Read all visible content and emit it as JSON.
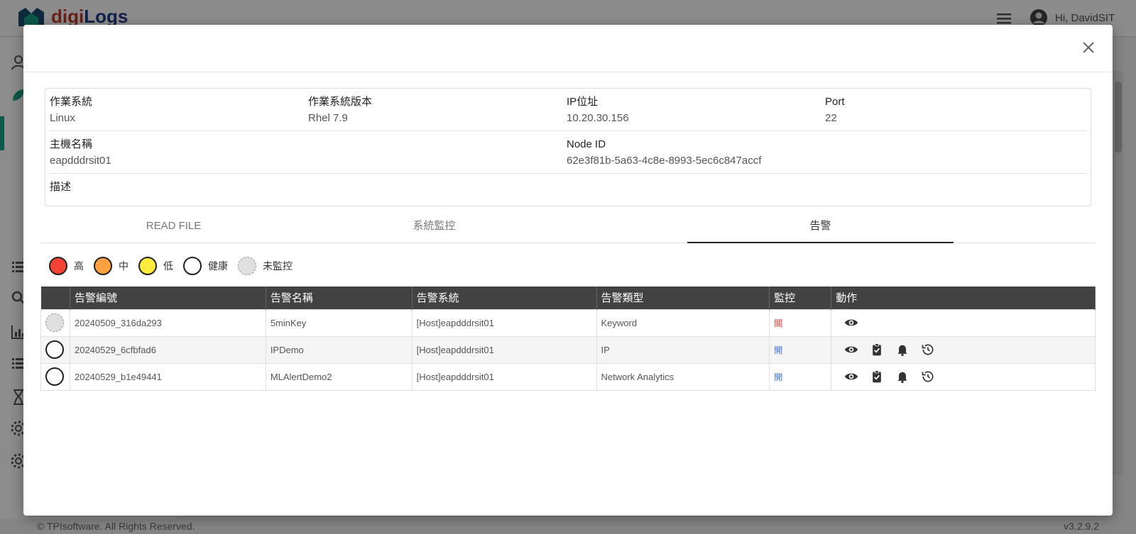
{
  "app": {
    "logo_part1": "digi",
    "logo_part2": "Logs",
    "greeting": "Hi, DavidSIT",
    "footer_left": "© TPIsoftware. All Rights Reserved.",
    "footer_right": "v3.2.9.2"
  },
  "info": {
    "os_label": "作業系統",
    "os_value": "Linux",
    "os_version_label": "作業系統版本",
    "os_version_value": "Rhel 7.9",
    "ip_label": "IP位址",
    "ip_value": "10.20.30.156",
    "port_label": "Port",
    "port_value": "22",
    "hostname_label": "主機名稱",
    "hostname_value": "eapdddrsit01",
    "node_id_label": "Node ID",
    "node_id_value": "62e3f81b-5a63-4c8e-8993-5ec6c847accf",
    "desc_label": "描述",
    "desc_value": ""
  },
  "tabs": [
    {
      "label": "READ FILE",
      "active": false
    },
    {
      "label": "系統監控",
      "active": false
    },
    {
      "label": "告警",
      "active": true
    }
  ],
  "legend": [
    {
      "label": "高",
      "color": "#f44336"
    },
    {
      "label": "中",
      "color": "#ffa040"
    },
    {
      "label": "低",
      "color": "#ffeb3b"
    },
    {
      "label": "健康",
      "color": "#ffffff"
    },
    {
      "label": "未監控",
      "color": "#e0e0e0"
    }
  ],
  "table": {
    "headers": [
      "",
      "告警編號",
      "告警名稱",
      "告警系統",
      "告警類型",
      "監控",
      "動作"
    ],
    "rows": [
      {
        "status": "unmonitored",
        "id": "20240509_316da293",
        "name": "5minKey",
        "system": "[Host]eapdddrsit01",
        "type": "Keyword",
        "monitor": "關",
        "monitor_color": "#e53935",
        "actions": [
          "view-icon"
        ]
      },
      {
        "status": "healthy",
        "id": "20240529_6cfbfad6",
        "name": "IPDemo",
        "system": "[Host]eapdddrsit01",
        "type": "IP",
        "monitor": "開",
        "monitor_color": "#3b6fd8",
        "actions": [
          "view-icon",
          "clipboard-icon",
          "bell-icon",
          "history-icon"
        ]
      },
      {
        "status": "healthy",
        "id": "20240529_b1e49441",
        "name": "MLAlertDemo2",
        "system": "[Host]eapdddrsit01",
        "type": "Network Analytics",
        "monitor": "開",
        "monitor_color": "#3b6fd8",
        "actions": [
          "view-icon",
          "clipboard-icon",
          "bell-icon",
          "history-icon"
        ]
      }
    ]
  }
}
